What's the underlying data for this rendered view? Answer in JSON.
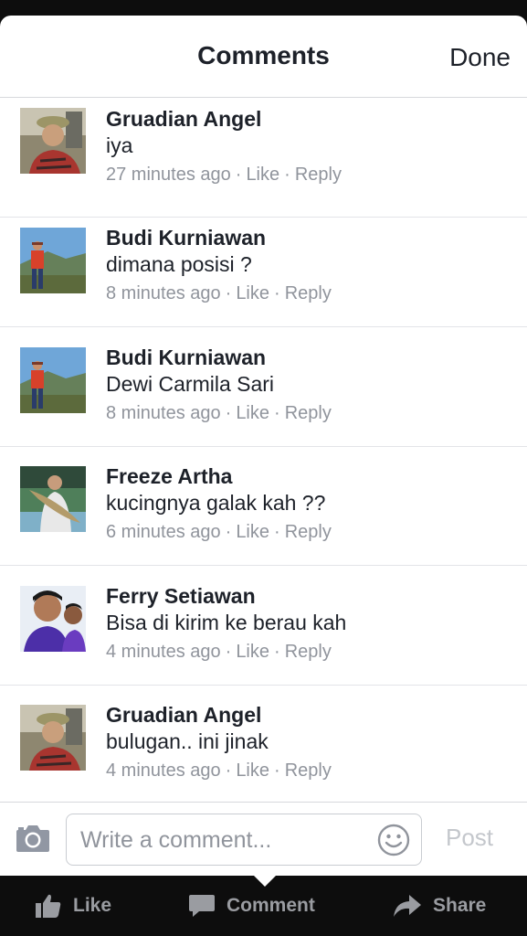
{
  "header": {
    "title": "Comments",
    "done_label": "Done"
  },
  "comments": [
    {
      "name": "Gruadian Angel",
      "text": "iya",
      "time": "27 minutes ago",
      "like": "Like",
      "reply": "Reply"
    },
    {
      "name": "Budi Kurniawan",
      "text": "dimana posisi ?",
      "time": "8 minutes ago",
      "like": "Like",
      "reply": "Reply"
    },
    {
      "name": "Budi Kurniawan",
      "text": "Dewi Carmila Sari",
      "time": "8 minutes ago",
      "like": "Like",
      "reply": "Reply"
    },
    {
      "name": "Freeze Artha",
      "text": "kucingnya galak kah ??",
      "time": "6 minutes ago",
      "like": "Like",
      "reply": "Reply"
    },
    {
      "name": "Ferry Setiawan",
      "text": "Bisa di kirim ke berau kah",
      "time": "4 minutes ago",
      "like": "Like",
      "reply": "Reply"
    },
    {
      "name": "Gruadian Angel",
      "text": "bulugan.. ini jinak",
      "time": "4 minutes ago",
      "like": "Like",
      "reply": "Reply"
    }
  ],
  "composer": {
    "placeholder": "Write a comment...",
    "post_label": "Post",
    "camera_icon": "camera-icon",
    "smiley_icon": "smiley-icon"
  },
  "tabbar": {
    "like_label": "Like",
    "comment_label": "Comment",
    "share_label": "Share"
  },
  "colors": {
    "text": "#1d2129",
    "meta": "#90949c",
    "tab": "#9a9ca1",
    "background": "#0d0d0d"
  }
}
